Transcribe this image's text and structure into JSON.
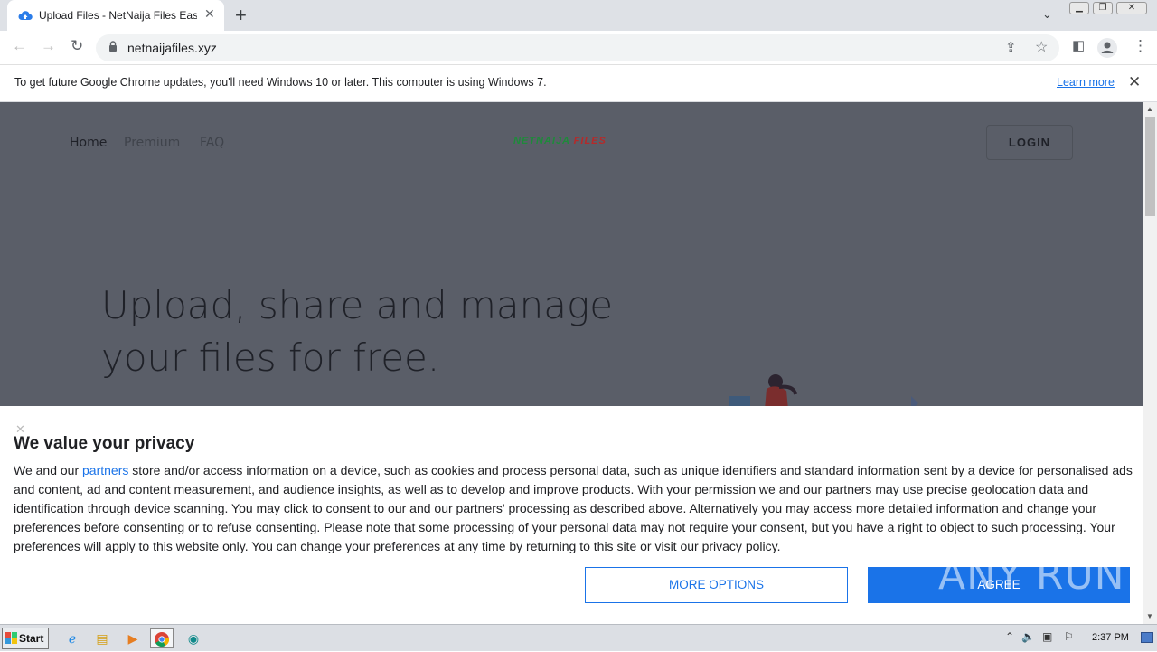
{
  "browser": {
    "tab_title": "Upload Files - NetNaija Files Easy Ac",
    "url": "netnaijafiles.xyz",
    "new_tab_symbol": "+",
    "window_controls": [
      "minimize",
      "restore",
      "close"
    ]
  },
  "infobar": {
    "message": "To get future Google Chrome updates, you'll need Windows 10 or later. This computer is using Windows 7.",
    "learn_more": "Learn more"
  },
  "site": {
    "nav": [
      "Home",
      "Premium",
      "FAQ"
    ],
    "logo_main": "NETNAIJA",
    "logo_accent": "FILES",
    "login": "LOGIN",
    "hero_line1": "Upload, share and manage",
    "hero_line2": "your files for free.",
    "colors": {
      "overlay": "#5a5e68",
      "logo_green": "#1e9a3e",
      "logo_red": "#d32f2f"
    }
  },
  "consent": {
    "title": "We value your privacy",
    "body_before_link": "We and our ",
    "link": "partners",
    "body_after_link": " store and/or access information on a device, such as cookies and process personal data, such as unique identifiers and standard information sent by a device for personalised ads and content, ad and content measurement, and audience insights, as well as to develop and improve products. With your permission we and our partners may use precise geolocation data and identification through device scanning. You may click to consent to our and our partners' processing as described above. Alternatively you may access more detailed information and change your preferences before consenting or to refuse consenting. Please note that some processing of your personal data may not require your consent, but you have a right to object to such processing. Your preferences will apply to this website only. You can change your preferences at any time by returning to this site or visit our privacy policy.",
    "more_options": "MORE OPTIONS",
    "agree": "AGREE",
    "accent": "#1a73e8"
  },
  "watermark": "ANY RUN",
  "taskbar": {
    "start": "Start",
    "clock": "2:37 PM"
  }
}
